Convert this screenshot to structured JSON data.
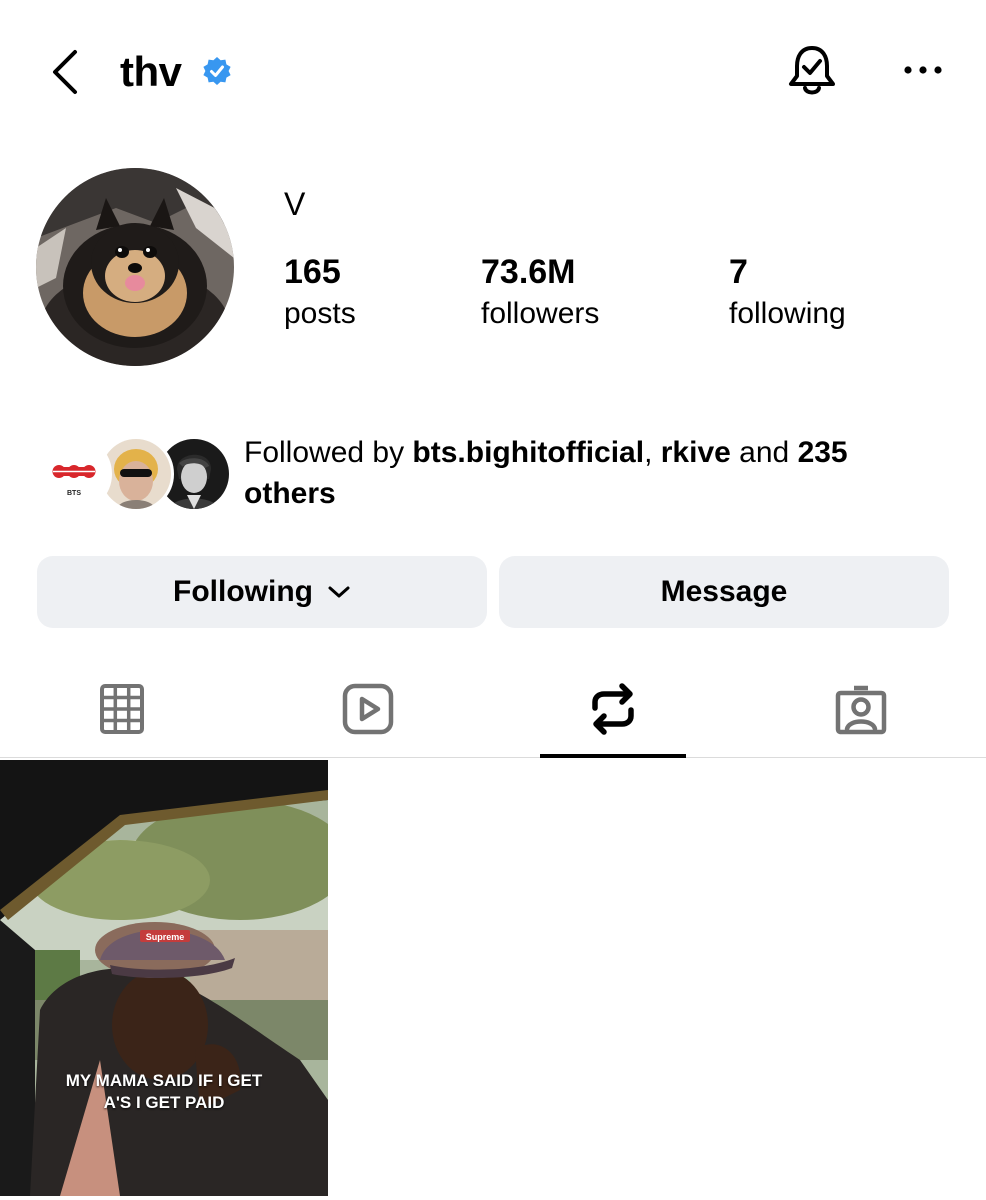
{
  "header": {
    "username": "thv",
    "back_icon": "chevron-left-icon",
    "verified_icon": "verified-badge-icon",
    "bell_icon": "bell-check-icon",
    "more_icon": "more-horizontal-icon"
  },
  "profile": {
    "display_name": "V",
    "stats": [
      {
        "value": "165",
        "label": "posts"
      },
      {
        "value": "73.6M",
        "label": "followers"
      },
      {
        "value": "7",
        "label": "following"
      }
    ]
  },
  "followed_by": {
    "prefix": "Followed by ",
    "user1": "bts.bighitofficial",
    "sep": ", ",
    "user2": "rkive",
    "mid": " and ",
    "count": "235",
    "suffix": "others",
    "bts_logo_text": "BTS"
  },
  "buttons": {
    "following": "Following",
    "message": "Message"
  },
  "tabs": [
    {
      "icon": "grid-icon"
    },
    {
      "icon": "reels-icon"
    },
    {
      "icon": "reposts-icon",
      "active": true
    },
    {
      "icon": "tagged-icon"
    }
  ],
  "posts": [
    {
      "caption_line1": "MY MAMA SAID IF I GET",
      "caption_line2": "A'S I GET PAID",
      "cap_text": "Supreme"
    }
  ],
  "colors": {
    "verified": "#3897f0",
    "button_bg": "#eef0f3",
    "tab_icon": "#737373",
    "bts_red": "#d8262b"
  }
}
